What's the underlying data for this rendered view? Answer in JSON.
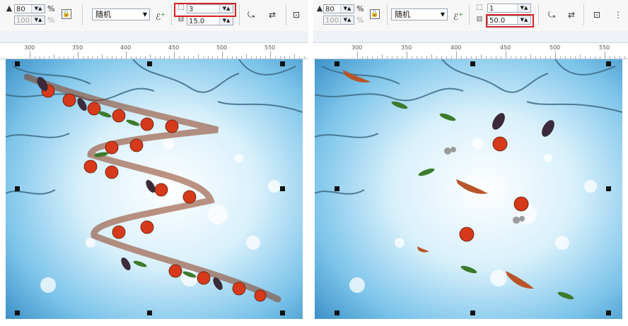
{
  "left": {
    "toolbar": {
      "spin_top": "80",
      "spin_bottom": "100",
      "percent_top": "%",
      "percent_bottom": "%",
      "mode_label": "随机",
      "field_top": "3",
      "field_bottom": "15.0"
    },
    "ruler": {
      "ticks": [
        "300",
        "350",
        "400",
        "450",
        "500",
        "550"
      ]
    }
  },
  "right": {
    "toolbar": {
      "spin_top": "80",
      "spin_bottom": "100",
      "percent_top": "%",
      "percent_bottom": "%",
      "mode_label": "随机",
      "field_top": "1",
      "field_bottom": "50.0"
    },
    "ruler": {
      "ticks": [
        "300",
        "350",
        "400",
        "450",
        "500",
        "550"
      ]
    }
  },
  "icons": [
    "lock-icon",
    "add-node-icon",
    "rotate-icon",
    "mirror-icon",
    "spacing-icon"
  ],
  "colors": {
    "highlight": "#d61f1f",
    "sky": "#bfe3f7",
    "tomato": "#d63a1a",
    "eggplant": "#3a2a3a"
  }
}
